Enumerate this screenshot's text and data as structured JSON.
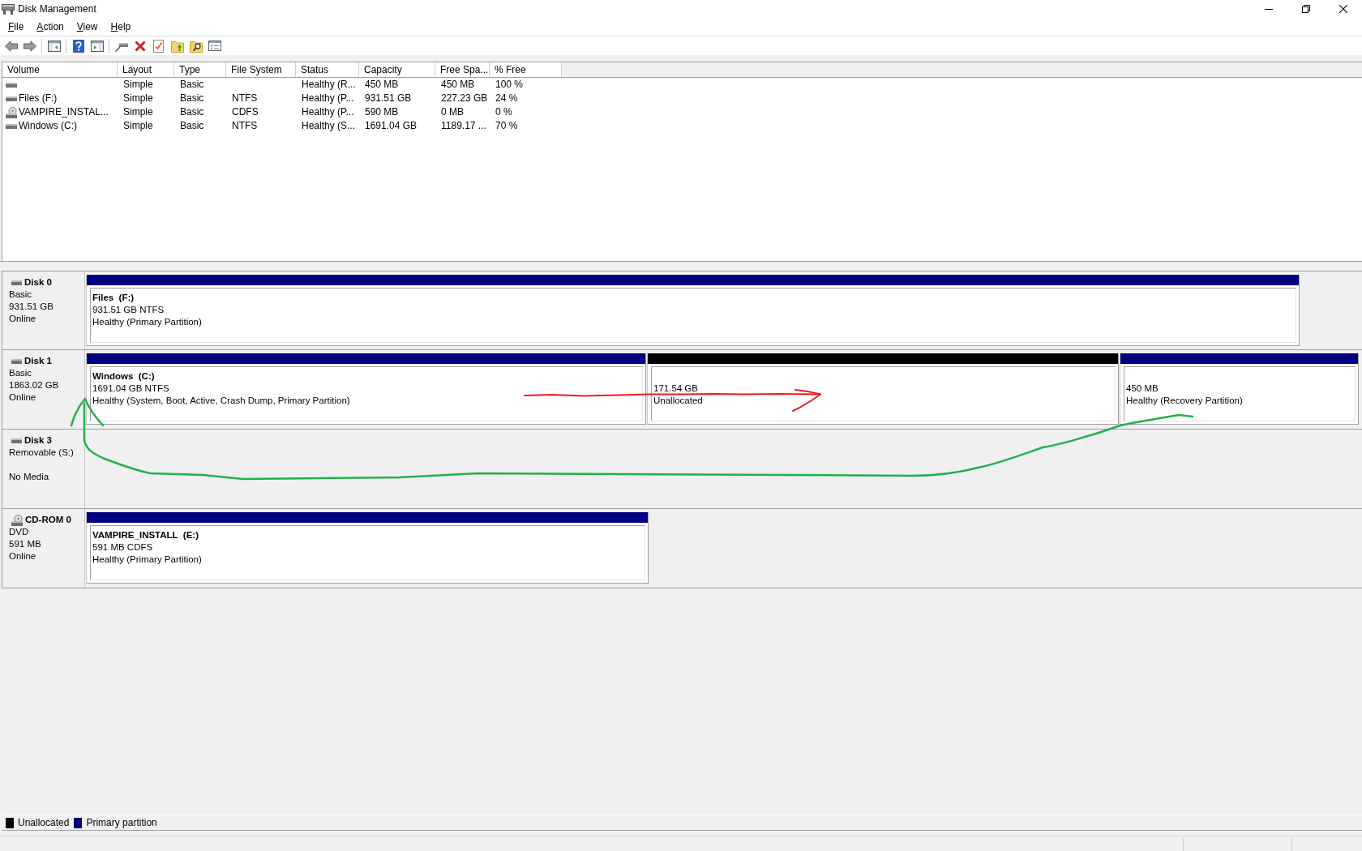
{
  "window": {
    "title": "Disk Management"
  },
  "menu": [
    "File",
    "Action",
    "View",
    "Help"
  ],
  "volume_table": {
    "columns": [
      "Volume",
      "Layout",
      "Type",
      "File System",
      "Status",
      "Capacity",
      "Free Spa...",
      "% Free"
    ],
    "rows": [
      {
        "kind": "disk",
        "layout": "Simple",
        "type": "Basic",
        "status": "Healthy (R...",
        "capacity": "450 MB",
        "free_space": "450 MB",
        "percent_free": "100 %"
      },
      {
        "kind": "disk",
        "volume": "Files (F:)",
        "layout": "Simple",
        "type": "Basic",
        "file_system": "NTFS",
        "status": "Healthy (P...",
        "capacity": "931.51 GB",
        "free_space": "227.23 GB",
        "percent_free": "24 %"
      },
      {
        "kind": "cdrom",
        "volume": "VAMPIRE_INSTAL...",
        "layout": "Simple",
        "type": "Basic",
        "file_system": "CDFS",
        "status": "Healthy (P...",
        "capacity": "590 MB",
        "free_space": "0 MB",
        "percent_free": "0 %"
      },
      {
        "kind": "disk",
        "volume": "Windows (C:)",
        "layout": "Simple",
        "type": "Basic",
        "file_system": "NTFS",
        "status": "Healthy (S...",
        "capacity": "1691.04 GB",
        "free_space": "1189.17 ...",
        "percent_free": "70 %"
      }
    ]
  },
  "disks": [
    {
      "kind": "disk",
      "name": "Disk 0",
      "type": "Basic",
      "size": "931.51 GB",
      "status": "Online",
      "partitions": [
        {
          "kind": "primary",
          "title": "Files  (F:)",
          "detail": "931.51 GB NTFS",
          "status": "Healthy (Primary Partition)"
        }
      ]
    },
    {
      "kind": "disk",
      "name": "Disk 1",
      "type": "Basic",
      "size": "1863.02 GB",
      "status": "Online",
      "partitions": [
        {
          "kind": "primary",
          "title": "Windows  (C:)",
          "detail": "1691.04 GB NTFS",
          "status": "Healthy (System, Boot, Active, Crash Dump, Primary Partition)"
        },
        {
          "kind": "unallocated",
          "detail": "171.54 GB",
          "status": "Unallocated"
        },
        {
          "kind": "primary",
          "detail": "450 MB",
          "status": "Healthy (Recovery Partition)"
        }
      ]
    },
    {
      "kind": "disk",
      "name": "Disk 3",
      "type": "Removable (S:)",
      "status": "No Media"
    },
    {
      "kind": "cdrom",
      "name": "CD-ROM 0",
      "type": "DVD",
      "size": "591 MB",
      "status": "Online",
      "partitions": [
        {
          "kind": "primary",
          "title": "VAMPIRE_INSTALL  (E:)",
          "detail": "591 MB CDFS",
          "status": "Healthy (Primary Partition)"
        }
      ]
    }
  ],
  "legend": [
    {
      "kind": "unallocated",
      "label": "Unallocated",
      "color": "#000000"
    },
    {
      "kind": "primary",
      "label": "Primary partition",
      "color": "#000080"
    }
  ]
}
